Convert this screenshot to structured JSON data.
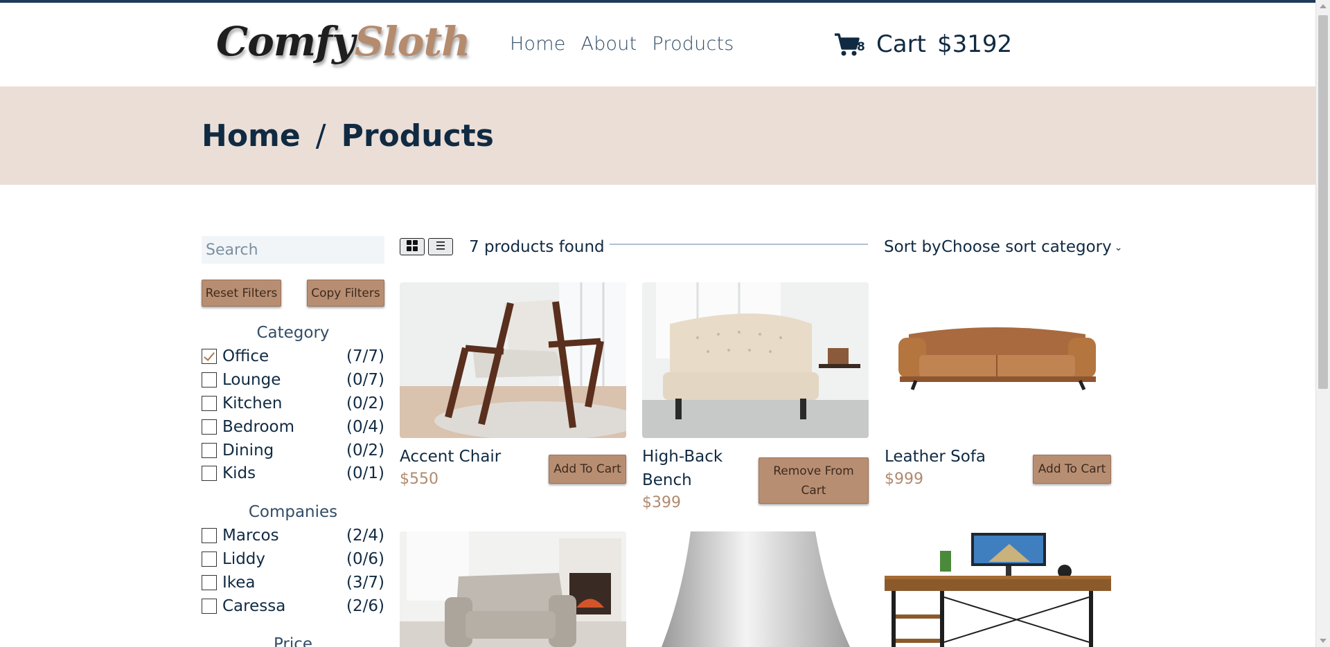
{
  "brand": {
    "part1": "Comfy",
    "part2": "Sloth"
  },
  "nav": {
    "links": [
      "Home",
      "About",
      "Products"
    ]
  },
  "cart": {
    "icon": "shopping-cart-icon",
    "count": "8",
    "label": "Cart",
    "total": "$3192"
  },
  "breadcrumb": {
    "home": "Home",
    "separator": "/",
    "current": "Products"
  },
  "filters": {
    "search_placeholder": "Search",
    "reset_label": "Reset Filters",
    "copy_label": "Copy Filters",
    "category_title": "Category",
    "categories": [
      {
        "name": "Office",
        "count": "(7/7)",
        "checked": true
      },
      {
        "name": "Lounge",
        "count": "(0/7)",
        "checked": false
      },
      {
        "name": "Kitchen",
        "count": "(0/2)",
        "checked": false
      },
      {
        "name": "Bedroom",
        "count": "(0/4)",
        "checked": false
      },
      {
        "name": "Dining",
        "count": "(0/2)",
        "checked": false
      },
      {
        "name": "Kids",
        "count": "(0/1)",
        "checked": false
      }
    ],
    "companies_title": "Companies",
    "companies": [
      {
        "name": "Marcos",
        "count": "(2/4)",
        "checked": false
      },
      {
        "name": "Liddy",
        "count": "(0/6)",
        "checked": false
      },
      {
        "name": "Ikea",
        "count": "(3/7)",
        "checked": false
      },
      {
        "name": "Caressa",
        "count": "(2/6)",
        "checked": false
      }
    ],
    "price_title": "Price"
  },
  "toolbar": {
    "grid_icon": "grid-view-icon",
    "list_icon": "list-view-icon",
    "products_found": "7 products found",
    "sort_label": "Sort by",
    "sort_value": "Choose sort category"
  },
  "products": [
    {
      "name": "Accent Chair",
      "price": "$550",
      "button": "Add To Cart"
    },
    {
      "name": "High-Back Bench",
      "price": "$399",
      "button": "Remove From Cart"
    },
    {
      "name": "Leather Sofa",
      "price": "$999",
      "button": "Add To Cart"
    }
  ]
}
